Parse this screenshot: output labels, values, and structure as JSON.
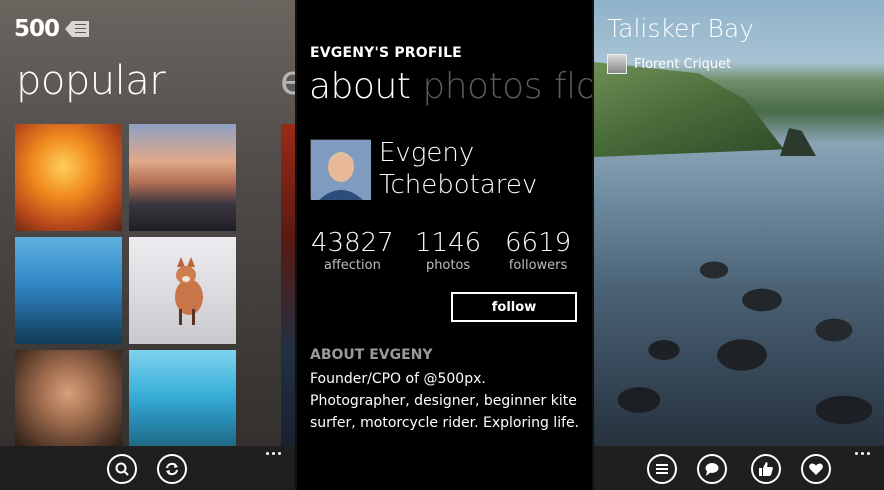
{
  "screen1": {
    "logo_text": "500",
    "pivot_title": "popular",
    "pivot_peek": "e",
    "appbar": {
      "search_icon": "search-icon",
      "refresh_icon": "refresh-icon",
      "more_icon": "more-dots-icon"
    }
  },
  "screen2": {
    "header": "EVGENY'S PROFILE",
    "tabs": [
      {
        "label": "about",
        "active": true
      },
      {
        "label": "photos",
        "active": false
      },
      {
        "label": "flow",
        "active": false
      }
    ],
    "name_line1": "Evgeny",
    "name_line2": "Tchebotarev",
    "stats": [
      {
        "value": "43827",
        "label": "affection"
      },
      {
        "value": "1146",
        "label": "photos"
      },
      {
        "value": "6619",
        "label": "followers"
      }
    ],
    "follow_label": "follow",
    "about_heading": "ABOUT EVGENY",
    "bio": "Founder/CPO of @500px. Photographer, designer, beginner kite surfer, motorcycle rider. Exploring life."
  },
  "screen3": {
    "photo_title": "Talisker Bay",
    "author": "Florent Criquet",
    "appbar": {
      "list_icon": "list-icon",
      "comment_icon": "comment-icon",
      "like_icon": "thumbs-up-icon",
      "favorite_icon": "heart-icon",
      "more_icon": "more-dots-icon"
    }
  },
  "colors": {
    "appbar_bg": "#1f1f1f",
    "text_primary": "#ffffff",
    "tab_inactive": "#5a5a5a",
    "section_heading": "#9a9a9a"
  }
}
